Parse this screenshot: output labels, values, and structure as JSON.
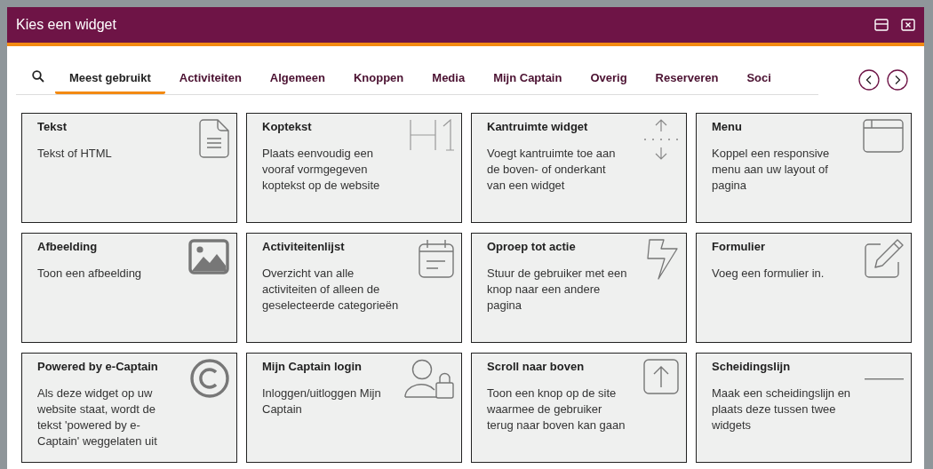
{
  "window": {
    "title": "Kies een widget"
  },
  "tabs": [
    {
      "label": "Meest gebruikt",
      "selected": true
    },
    {
      "label": "Activiteiten",
      "selected": false
    },
    {
      "label": "Algemeen",
      "selected": false
    },
    {
      "label": "Knoppen",
      "selected": false
    },
    {
      "label": "Media",
      "selected": false
    },
    {
      "label": "Mijn Captain",
      "selected": false
    },
    {
      "label": "Overig",
      "selected": false
    },
    {
      "label": "Reserveren",
      "selected": false
    },
    {
      "label": "Soci",
      "selected": false
    }
  ],
  "widgets": [
    {
      "title": "Tekst",
      "description": "Tekst of HTML"
    },
    {
      "title": "Koptekst",
      "description": "Plaats eenvoudig een vooraf vormgegeven koptekst op de website"
    },
    {
      "title": "Kantruimte widget",
      "description": "Voegt kantruimte toe aan de boven- of onderkant van een widget"
    },
    {
      "title": "Menu",
      "description": "Koppel een responsive menu aan uw layout of pagina"
    },
    {
      "title": "Afbeelding",
      "description": "Toon een afbeelding"
    },
    {
      "title": "Activiteitenlijst",
      "description": "Overzicht van alle activiteiten of alleen de geselecteerde categorieën"
    },
    {
      "title": "Oproep tot actie",
      "description": "Stuur de gebruiker met een knop naar een andere pagina"
    },
    {
      "title": "Formulier",
      "description": "Voeg een formulier in."
    },
    {
      "title": "Powered by e-Captain",
      "description": "Als deze widget op uw website staat, wordt de tekst 'powered by e-Captain' weggelaten uit"
    },
    {
      "title": "Mijn Captain login",
      "description": "Inloggen/uitloggen Mijn Captain"
    },
    {
      "title": "Scroll naar boven",
      "description": "Toon een knop op de site waarmee de gebruiker terug naar boven kan gaan"
    },
    {
      "title": "Scheidingslijn",
      "description": "Maak een scheidingslijn en plaats deze tussen twee widgets"
    }
  ]
}
